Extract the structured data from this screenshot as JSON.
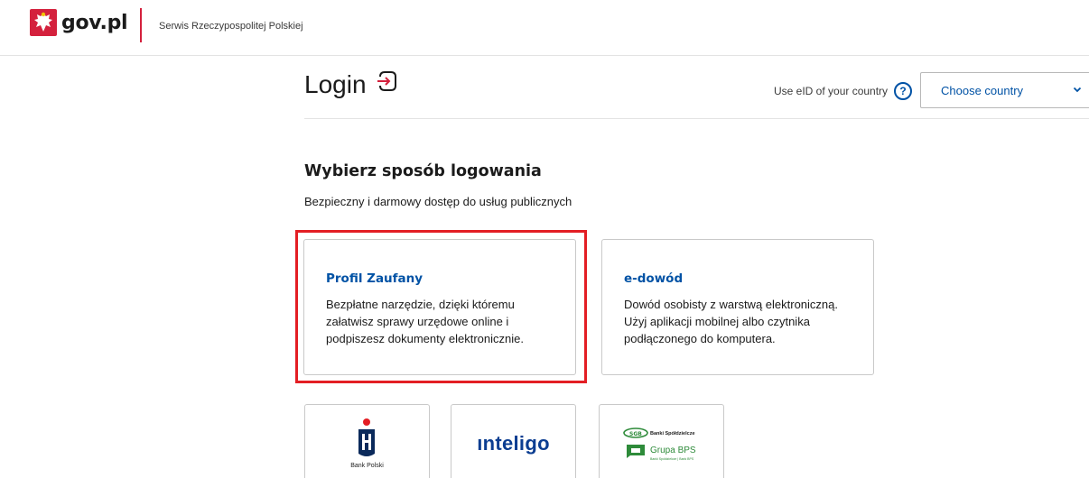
{
  "header": {
    "logo_text": "gov.pl",
    "service_name": "Serwis Rzeczypospolitej Polskiej"
  },
  "login": {
    "title": "Login",
    "eid_label": "Use eID of your country",
    "help_symbol": "?",
    "country_select": {
      "selected": "Choose country"
    }
  },
  "section": {
    "title": "Wybierz sposób logowania",
    "subtitle": "Bezpieczny i darmowy dostęp do usług publicznych"
  },
  "methods": [
    {
      "title": "Profil Zaufany",
      "description": "Bezpłatne narzędzie, dzięki któremu załatwisz sprawy urzędowe online i podpiszesz dokumenty elektronicznie.",
      "highlighted": true
    },
    {
      "title": "e-dowód",
      "description": "Dowód osobisty z warstwą elektroniczną. Użyj aplikacji mobilnej albo czytnika podłączonego do komputera.",
      "highlighted": false
    }
  ],
  "banks": [
    {
      "name": "PKO Bank Polski",
      "caption": "Bank Polski"
    },
    {
      "name": "inteligo",
      "logo_text": "ınteligo"
    },
    {
      "name": "Banki Spółdzielcze Grupa BPS",
      "top_text": "Banki Spółdzielcze",
      "group_text": "Grupa BPS",
      "sub_text": "Banki Spółdzielcze | Bank BPS"
    }
  ],
  "colors": {
    "brand_red": "#d4213d",
    "link_blue": "#0052a5",
    "highlight_red": "#e31e24",
    "bps_green": "#2e8b3a"
  },
  "icons": [
    "poland-eagle-emblem-icon",
    "login-arrow-icon",
    "help-circle-icon",
    "chevron-down-icon"
  ]
}
